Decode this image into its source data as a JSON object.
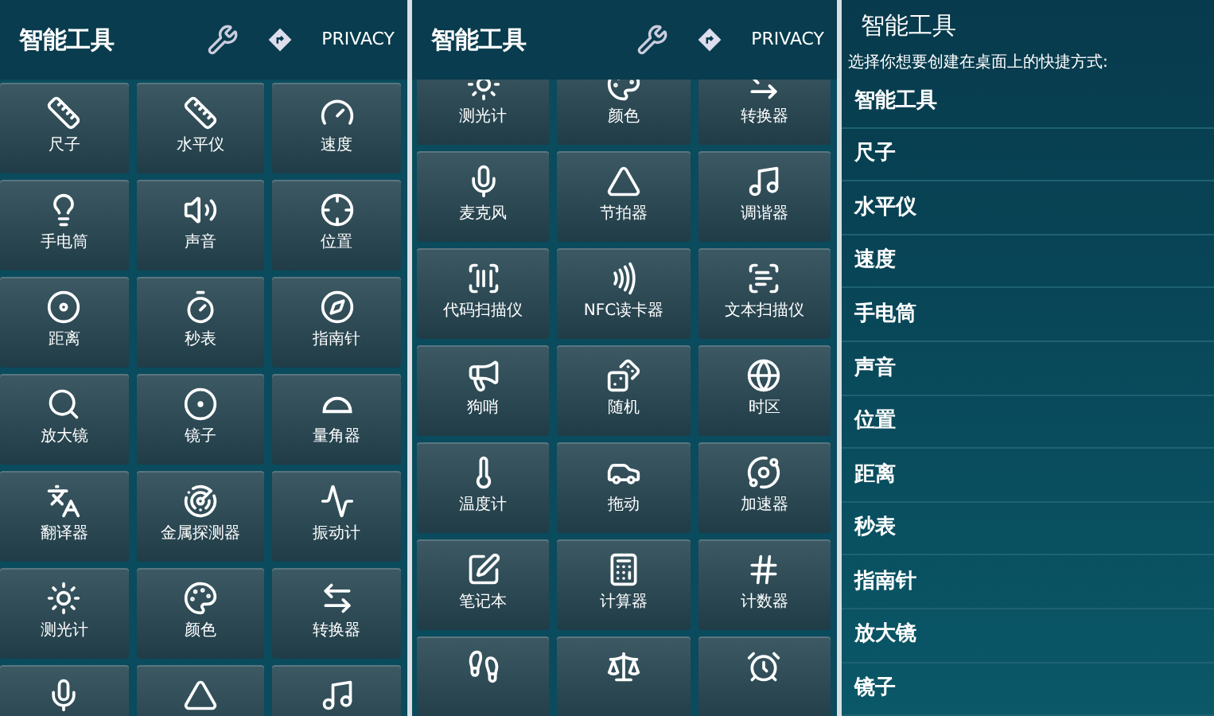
{
  "screens": [
    {
      "kind": "grid",
      "scrolled": false,
      "title": "智能工具",
      "privacy": "PRIVACY",
      "tiles": [
        {
          "kind": "tile",
          "label": "尺子"
        },
        {
          "kind": "tile",
          "label": "水平仪"
        },
        {
          "kind": "tile",
          "label": "速度"
        },
        {
          "kind": "tile",
          "label": "手电筒"
        },
        {
          "kind": "tile",
          "label": "声音"
        },
        {
          "kind": "tile",
          "label": "位置"
        },
        {
          "kind": "tile",
          "label": "距离"
        },
        {
          "kind": "tile",
          "label": "秒表"
        },
        {
          "kind": "tile",
          "label": "指南针"
        },
        {
          "kind": "tile",
          "label": "放大镜"
        },
        {
          "kind": "tile",
          "label": "镜子"
        },
        {
          "kind": "tile",
          "label": "量角器"
        },
        {
          "kind": "tile",
          "label": "翻译器"
        },
        {
          "kind": "tile",
          "label": "金属探测器"
        },
        {
          "kind": "tile",
          "label": "振动计"
        },
        {
          "kind": "tile",
          "label": "测光计"
        },
        {
          "kind": "tile",
          "label": "颜色"
        },
        {
          "kind": "tile",
          "label": "转换器"
        },
        {
          "kind": "cut"
        },
        {
          "kind": "cut"
        },
        {
          "kind": "cut"
        }
      ]
    },
    {
      "kind": "grid",
      "scrolled": true,
      "title": "智能工具",
      "privacy": "PRIVACY",
      "tiles": [
        {
          "kind": "tile",
          "label": "测光计"
        },
        {
          "kind": "tile",
          "label": "颜色"
        },
        {
          "kind": "tile",
          "label": "转换器"
        },
        {
          "kind": "tile",
          "label": "麦克风"
        },
        {
          "kind": "tile",
          "label": "节拍器"
        },
        {
          "kind": "tile",
          "label": "调谐器"
        },
        {
          "kind": "tile",
          "label": "代码扫描仪"
        },
        {
          "kind": "tile",
          "label": "NFC读卡器"
        },
        {
          "kind": "tile",
          "label": "文本扫描仪"
        },
        {
          "kind": "tile",
          "label": "狗哨"
        },
        {
          "kind": "tile",
          "label": "随机"
        },
        {
          "kind": "tile",
          "label": "时区"
        },
        {
          "kind": "tile",
          "label": "温度计"
        },
        {
          "kind": "tile",
          "label": "拖动"
        },
        {
          "kind": "tile",
          "label": "加速器"
        },
        {
          "kind": "tile",
          "label": "笔记本"
        },
        {
          "kind": "tile",
          "label": "计算器"
        },
        {
          "kind": "tile",
          "label": "计数器"
        },
        {
          "kind": "cut"
        },
        {
          "kind": "cut"
        },
        {
          "kind": "cut"
        }
      ]
    },
    {
      "kind": "list",
      "title": "智能工具",
      "subtitle": "选择你想要创建在桌面上的快捷方式:",
      "items": [
        "智能工具",
        "尺子",
        "水平仪",
        "速度",
        "手电筒",
        "声音",
        "位置",
        "距离",
        "秒表",
        "指南针",
        "放大镜",
        "镜子"
      ]
    }
  ]
}
